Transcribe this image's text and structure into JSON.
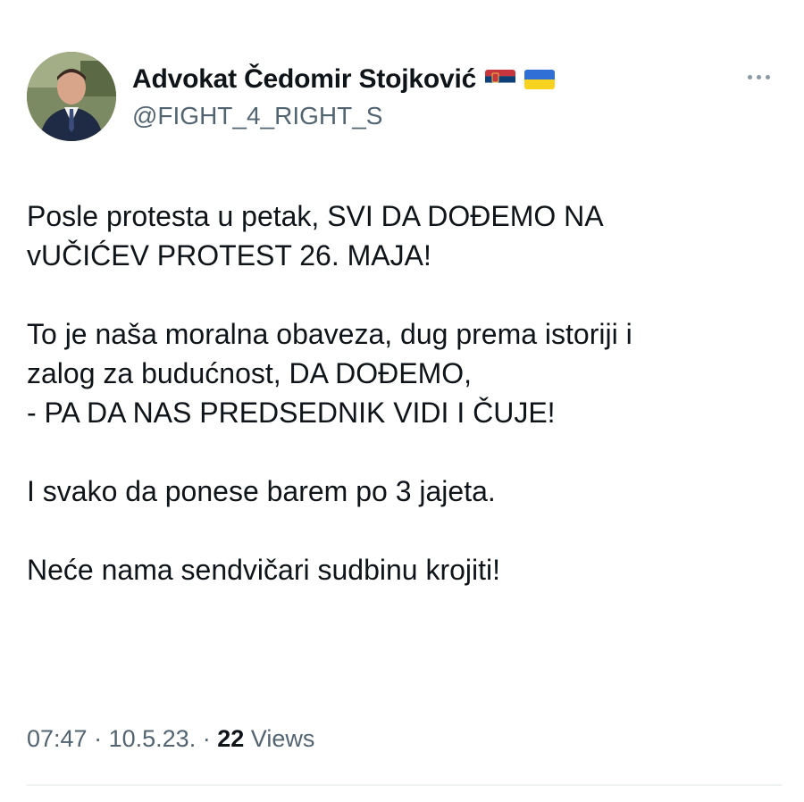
{
  "author": {
    "display_name": "Advokat Čedomir Stojković",
    "handle": "@FIGHT_4_RIGHT_S",
    "flags": [
      "serbia-flag",
      "ukraine-flag"
    ]
  },
  "tweet": {
    "paragraphs": [
      [
        "Posle protesta u petak, SVI DA DOĐEMO NA",
        "vUČIĆEV PROTEST 26. MAJA!"
      ],
      [
        "To je naša moralna obaveza, dug prema istoriji i",
        "zalog za budućnost, DA DOĐEMO,",
        "- PA DA NAS PREDSEDNIK VIDI I ČUJE!"
      ],
      [
        "I svako da ponese barem po 3 jajeta."
      ],
      [
        "Neće nama sendvičari sudbinu krojiti!"
      ]
    ]
  },
  "meta": {
    "time": "07:47",
    "date": "10.5.23.",
    "separator": "·",
    "views_count": "22",
    "views_label": "Views"
  },
  "colors": {
    "text_primary": "#0f1419",
    "text_secondary": "#536471",
    "divider": "#eff3f4"
  },
  "icons": {
    "more": "more-horizontal-icon"
  }
}
